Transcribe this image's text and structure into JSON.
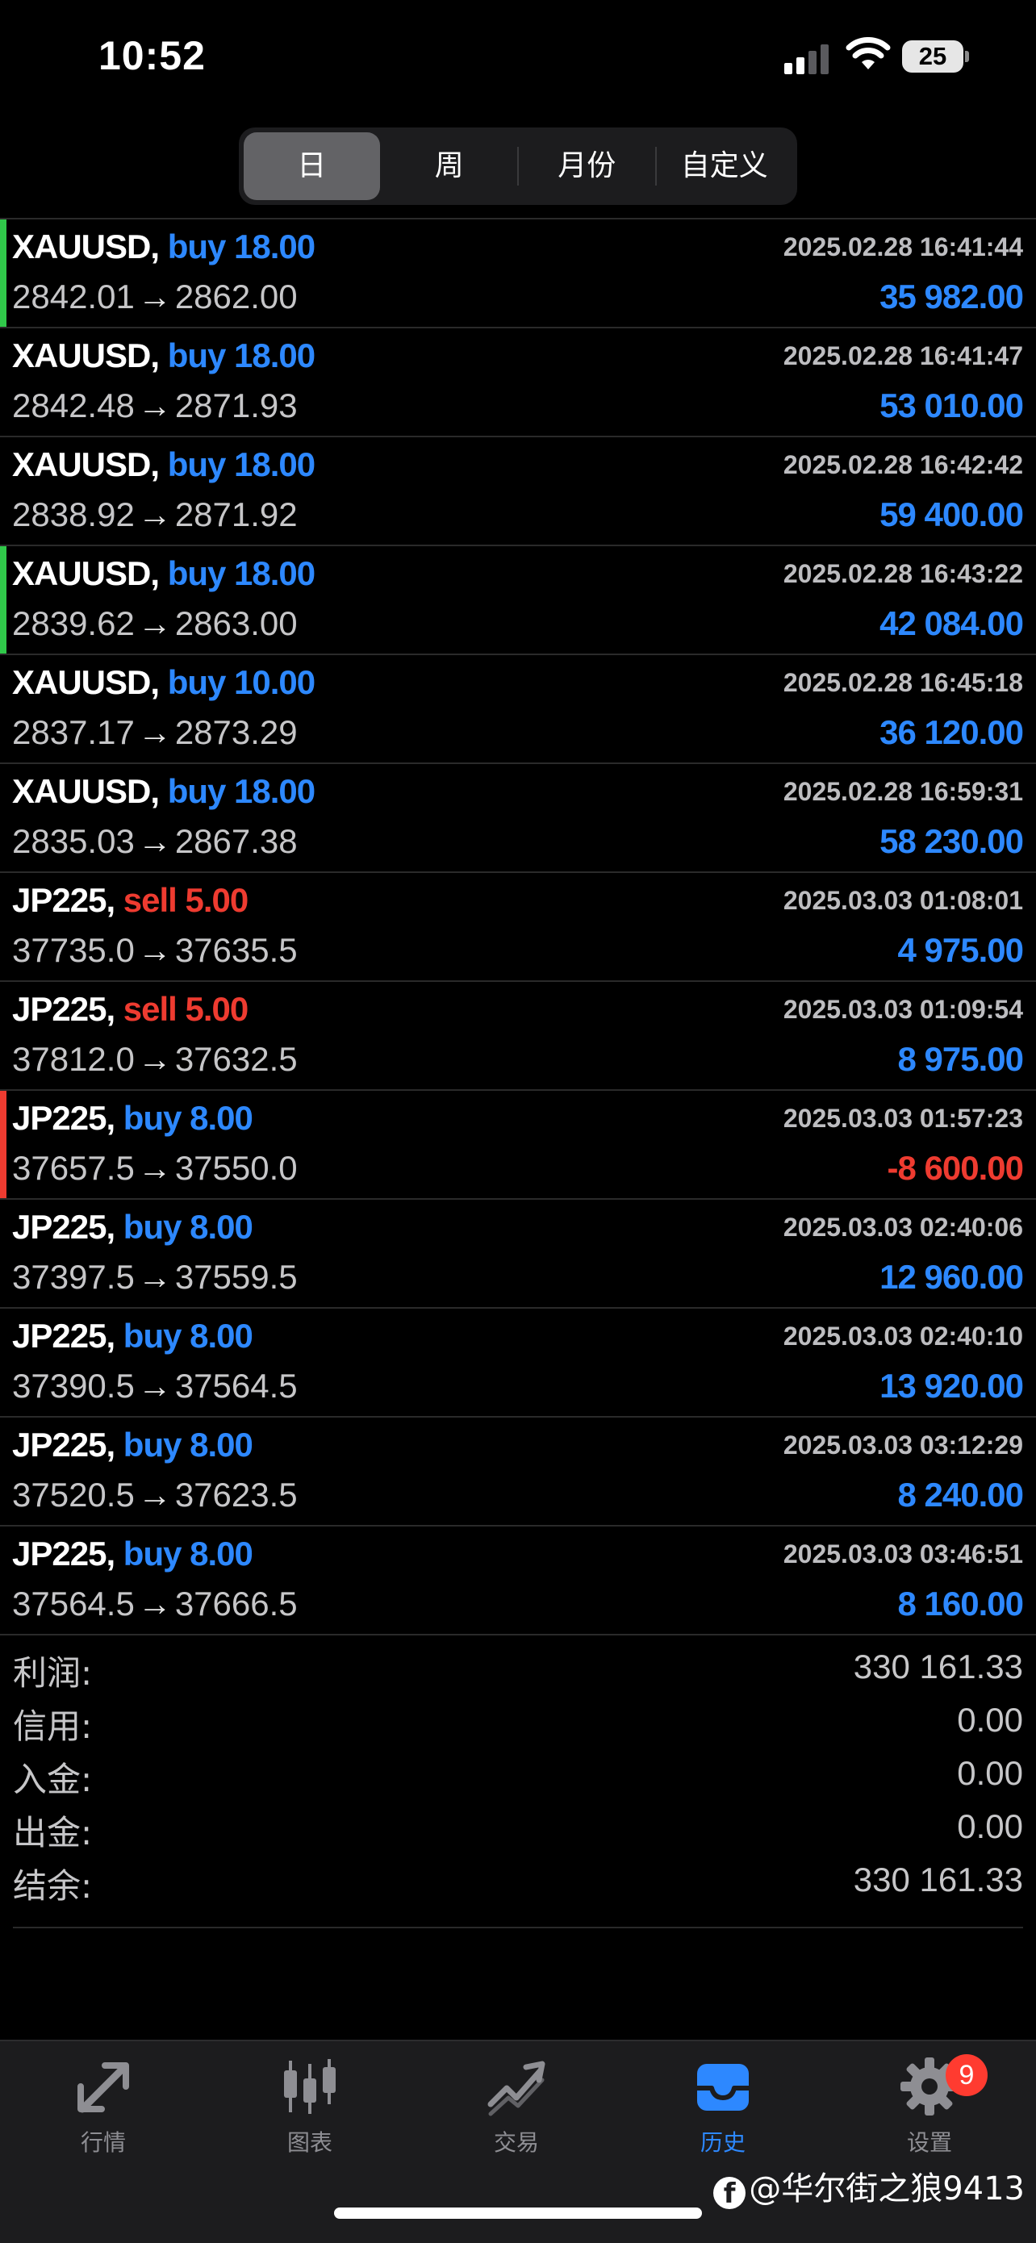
{
  "status_bar": {
    "time": "10:52",
    "battery": "25"
  },
  "period_tabs": [
    {
      "label": "日",
      "active": true
    },
    {
      "label": "周",
      "active": false
    },
    {
      "label": "月份",
      "active": false
    },
    {
      "label": "自定义",
      "active": false
    }
  ],
  "deals": [
    {
      "symbol": "XAUUSD,",
      "side": "buy",
      "volume": "18.00",
      "open": "2842.01",
      "close": "2862.00",
      "time": "2025.02.28 16:41:44",
      "profit": "35 982.00",
      "marker": "#30c94a"
    },
    {
      "symbol": "XAUUSD,",
      "side": "buy",
      "volume": "18.00",
      "open": "2842.48",
      "close": "2871.93",
      "time": "2025.02.28 16:41:47",
      "profit": "53 010.00",
      "marker": ""
    },
    {
      "symbol": "XAUUSD,",
      "side": "buy",
      "volume": "18.00",
      "open": "2838.92",
      "close": "2871.92",
      "time": "2025.02.28 16:42:42",
      "profit": "59 400.00",
      "marker": ""
    },
    {
      "symbol": "XAUUSD,",
      "side": "buy",
      "volume": "18.00",
      "open": "2839.62",
      "close": "2863.00",
      "time": "2025.02.28 16:43:22",
      "profit": "42 084.00",
      "marker": "#30c94a"
    },
    {
      "symbol": "XAUUSD,",
      "side": "buy",
      "volume": "10.00",
      "open": "2837.17",
      "close": "2873.29",
      "time": "2025.02.28 16:45:18",
      "profit": "36 120.00",
      "marker": ""
    },
    {
      "symbol": "XAUUSD,",
      "side": "buy",
      "volume": "18.00",
      "open": "2835.03",
      "close": "2867.38",
      "time": "2025.02.28 16:59:31",
      "profit": "58 230.00",
      "marker": ""
    },
    {
      "symbol": "JP225,",
      "side": "sell",
      "volume": "5.00",
      "open": "37735.0",
      "close": "37635.5",
      "time": "2025.03.03 01:08:01",
      "profit": "4 975.00",
      "marker": ""
    },
    {
      "symbol": "JP225,",
      "side": "sell",
      "volume": "5.00",
      "open": "37812.0",
      "close": "37632.5",
      "time": "2025.03.03 01:09:54",
      "profit": "8 975.00",
      "marker": ""
    },
    {
      "symbol": "JP225,",
      "side": "buy",
      "volume": "8.00",
      "open": "37657.5",
      "close": "37550.0",
      "time": "2025.03.03 01:57:23",
      "profit": "-8 600.00",
      "marker": "#ee3b30"
    },
    {
      "symbol": "JP225,",
      "side": "buy",
      "volume": "8.00",
      "open": "37397.5",
      "close": "37559.5",
      "time": "2025.03.03 02:40:06",
      "profit": "12 960.00",
      "marker": ""
    },
    {
      "symbol": "JP225,",
      "side": "buy",
      "volume": "8.00",
      "open": "37390.5",
      "close": "37564.5",
      "time": "2025.03.03 02:40:10",
      "profit": "13 920.00",
      "marker": ""
    },
    {
      "symbol": "JP225,",
      "side": "buy",
      "volume": "8.00",
      "open": "37520.5",
      "close": "37623.5",
      "time": "2025.03.03 03:12:29",
      "profit": "8 240.00",
      "marker": ""
    },
    {
      "symbol": "JP225,",
      "side": "buy",
      "volume": "8.00",
      "open": "37564.5",
      "close": "37666.5",
      "time": "2025.03.03 03:46:51",
      "profit": "8 160.00",
      "marker": ""
    }
  ],
  "price_arrow": "→",
  "summary": [
    {
      "label": "利润:",
      "value": "330 161.33"
    },
    {
      "label": "信用:",
      "value": "0.00"
    },
    {
      "label": "入金:",
      "value": "0.00"
    },
    {
      "label": "出金:",
      "value": "0.00"
    },
    {
      "label": "结余:",
      "value": "330 161.33"
    }
  ],
  "tab_bar": {
    "tabs": [
      {
        "label": "行情",
        "icon": "quotes-arrows-icon",
        "active": false
      },
      {
        "label": "图表",
        "icon": "candlestick-chart-icon",
        "active": false
      },
      {
        "label": "交易",
        "icon": "trade-trend-icon",
        "active": false
      },
      {
        "label": "历史",
        "icon": "history-inbox-icon",
        "active": true
      },
      {
        "label": "设置",
        "icon": "gear-icon",
        "active": false,
        "badge": "9"
      }
    ]
  },
  "watermark": {
    "logo": "f",
    "text": "@华尔街之狼9413"
  },
  "colors": {
    "background": "#000000",
    "buy_blue": "#2d88ff",
    "sell_red": "#ee3b30",
    "tab_bar_bg": "#1c1c1e",
    "segment_active": "#636366"
  }
}
